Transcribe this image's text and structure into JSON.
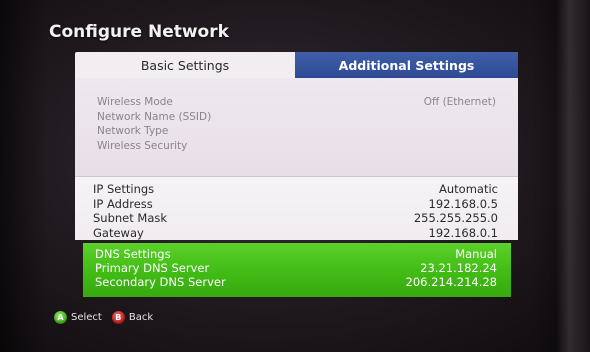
{
  "page": {
    "title": "Configure Network"
  },
  "tabs": [
    {
      "label": "Basic Settings",
      "selected": true
    },
    {
      "label": "Additional Settings",
      "selected": false
    }
  ],
  "wireless": [
    {
      "label": "Wireless Mode",
      "value": "Off (Ethernet)"
    },
    {
      "label": "Network Name (SSID)",
      "value": ""
    },
    {
      "label": "Network Type",
      "value": ""
    },
    {
      "label": "Wireless Security",
      "value": ""
    }
  ],
  "ip": [
    {
      "label": "IP Settings",
      "value": "Automatic"
    },
    {
      "label": "IP Address",
      "value": "192.168.0.5"
    },
    {
      "label": "Subnet Mask",
      "value": "255.255.255.0"
    },
    {
      "label": "Gateway",
      "value": "192.168.0.1"
    }
  ],
  "dns": [
    {
      "label": "DNS Settings",
      "value": "Manual"
    },
    {
      "label": "Primary DNS Server",
      "value": "23.21.182.24"
    },
    {
      "label": "Secondary DNS Server",
      "value": "206.214.214.28"
    }
  ],
  "hints": {
    "a": {
      "glyph": "A",
      "label": "Select"
    },
    "b": {
      "glyph": "B",
      "label": "Back"
    }
  },
  "colors": {
    "tab_active_bg": "#f1edf0",
    "tab_inactive_bg": "#2e4a94",
    "highlight_green": "#43bd17",
    "a_button": "#3fae1d",
    "b_button": "#c41b1b"
  }
}
